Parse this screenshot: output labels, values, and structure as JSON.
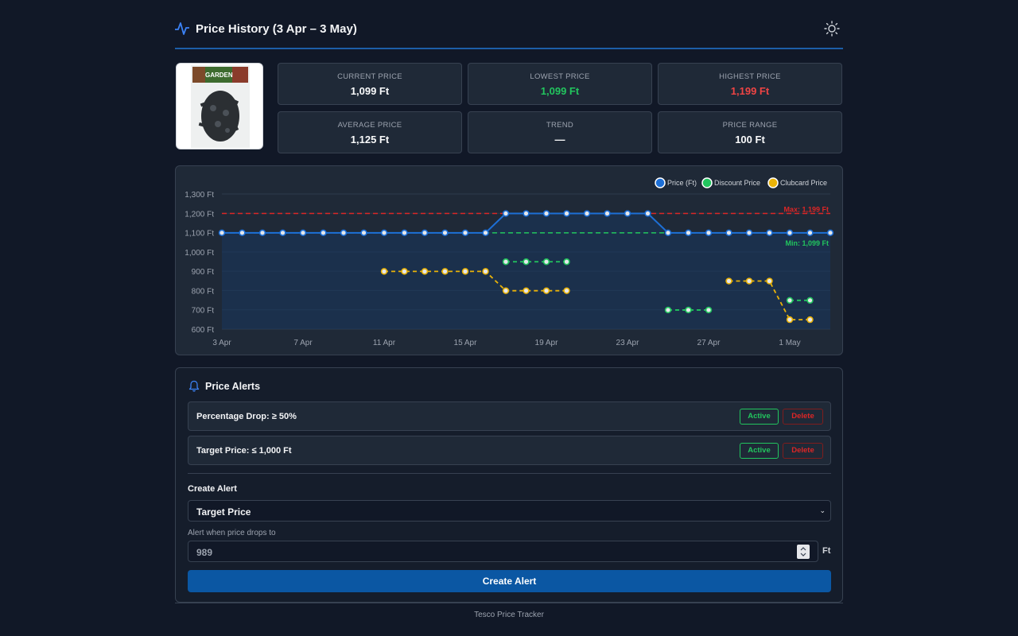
{
  "header": {
    "title": "Price History (3 Apr – 3 May)",
    "icon": "activity-pulse-icon",
    "theme_toggle_icon": "sun-icon"
  },
  "product": {
    "image_alt": "GARDEN",
    "logo_text": "GARDEN"
  },
  "stats": [
    {
      "label": "CURRENT PRICE",
      "value": "1,099 Ft",
      "tone": "normal"
    },
    {
      "label": "LOWEST PRICE",
      "value": "1,099 Ft",
      "tone": "green"
    },
    {
      "label": "HIGHEST PRICE",
      "value": "1,199 Ft",
      "tone": "red"
    },
    {
      "label": "AVERAGE PRICE",
      "value": "1,125 Ft",
      "tone": "normal"
    },
    {
      "label": "TREND",
      "value": "—",
      "tone": "normal"
    },
    {
      "label": "PRICE RANGE",
      "value": "100 Ft",
      "tone": "normal"
    }
  ],
  "chart_data": {
    "type": "line",
    "x": [
      "3 Apr",
      "4 Apr",
      "5 Apr",
      "6 Apr",
      "7 Apr",
      "8 Apr",
      "9 Apr",
      "10 Apr",
      "11 Apr",
      "12 Apr",
      "13 Apr",
      "14 Apr",
      "15 Apr",
      "16 Apr",
      "17 Apr",
      "18 Apr",
      "19 Apr",
      "20 Apr",
      "21 Apr",
      "22 Apr",
      "23 Apr",
      "24 Apr",
      "25 Apr",
      "26 Apr",
      "27 Apr",
      "28 Apr",
      "29 Apr",
      "30 Apr",
      "1 May",
      "2 May",
      "3 May"
    ],
    "x_ticks": [
      "3 Apr",
      "7 Apr",
      "11 Apr",
      "15 Apr",
      "19 Apr",
      "23 Apr",
      "27 Apr",
      "1 May"
    ],
    "y_ticks": [
      "600 Ft",
      "700 Ft",
      "800 Ft",
      "900 Ft",
      "1,000 Ft",
      "1,100 Ft",
      "1,200 Ft",
      "1,300 Ft"
    ],
    "ylim": [
      600,
      1300
    ],
    "series": [
      {
        "name": "Price (Ft)",
        "color": "#1d6fd6",
        "values": [
          1099,
          1099,
          1099,
          1099,
          1099,
          1099,
          1099,
          1099,
          1099,
          1099,
          1099,
          1099,
          1099,
          1099,
          1199,
          1199,
          1199,
          1199,
          1199,
          1199,
          1199,
          1199,
          1099,
          1099,
          1099,
          1099,
          1099,
          1099,
          1099,
          1099,
          1099
        ]
      },
      {
        "name": "Discount Price",
        "color": "#22c55e",
        "values": [
          null,
          null,
          null,
          null,
          null,
          null,
          null,
          null,
          null,
          null,
          null,
          null,
          null,
          null,
          949,
          949,
          949,
          949,
          null,
          null,
          null,
          null,
          699,
          699,
          699,
          null,
          null,
          null,
          749,
          749,
          null
        ]
      },
      {
        "name": "Clubcard Price",
        "color": "#eab308",
        "values": [
          null,
          null,
          null,
          null,
          null,
          null,
          null,
          null,
          899,
          899,
          899,
          899,
          899,
          899,
          799,
          799,
          799,
          799,
          null,
          null,
          null,
          null,
          null,
          null,
          null,
          849,
          849,
          849,
          649,
          649,
          null
        ]
      }
    ],
    "reference_lines": [
      {
        "label": "Max: 1,199 Ft",
        "value": 1199,
        "color": "#dc2626"
      },
      {
        "label": "Min: 1,099 Ft",
        "value": 1099,
        "color": "#22c55e"
      }
    ],
    "legend": "top-right",
    "grid": true
  },
  "alerts": {
    "title": "Price Alerts",
    "icon": "bell-icon",
    "items": [
      {
        "text": "Percentage Drop: ≥ 50%",
        "status": "Active",
        "delete": "Delete"
      },
      {
        "text": "Target Price: ≤ 1,000 Ft",
        "status": "Active",
        "delete": "Delete"
      }
    ],
    "create_label": "Create Alert",
    "type_selected": "Target Price",
    "drop_label": "Alert when price drops to",
    "value": "989",
    "unit": "Ft",
    "create_button": "Create Alert"
  },
  "footer": "Tesco Price Tracker"
}
